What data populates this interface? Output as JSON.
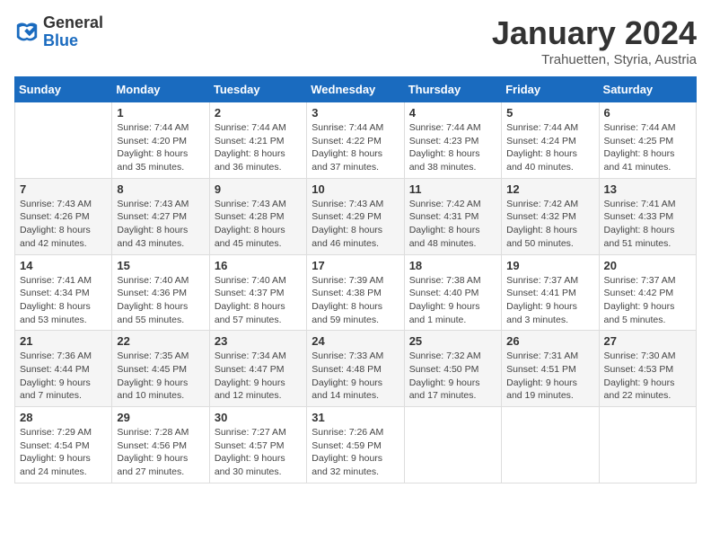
{
  "header": {
    "logo_general": "General",
    "logo_blue": "Blue",
    "month_title": "January 2024",
    "subtitle": "Trahuetten, Styria, Austria"
  },
  "weekdays": [
    "Sunday",
    "Monday",
    "Tuesday",
    "Wednesday",
    "Thursday",
    "Friday",
    "Saturday"
  ],
  "weeks": [
    [
      {
        "day": "",
        "sunrise": "",
        "sunset": "",
        "daylight": ""
      },
      {
        "day": "1",
        "sunrise": "Sunrise: 7:44 AM",
        "sunset": "Sunset: 4:20 PM",
        "daylight": "Daylight: 8 hours and 35 minutes."
      },
      {
        "day": "2",
        "sunrise": "Sunrise: 7:44 AM",
        "sunset": "Sunset: 4:21 PM",
        "daylight": "Daylight: 8 hours and 36 minutes."
      },
      {
        "day": "3",
        "sunrise": "Sunrise: 7:44 AM",
        "sunset": "Sunset: 4:22 PM",
        "daylight": "Daylight: 8 hours and 37 minutes."
      },
      {
        "day": "4",
        "sunrise": "Sunrise: 7:44 AM",
        "sunset": "Sunset: 4:23 PM",
        "daylight": "Daylight: 8 hours and 38 minutes."
      },
      {
        "day": "5",
        "sunrise": "Sunrise: 7:44 AM",
        "sunset": "Sunset: 4:24 PM",
        "daylight": "Daylight: 8 hours and 40 minutes."
      },
      {
        "day": "6",
        "sunrise": "Sunrise: 7:44 AM",
        "sunset": "Sunset: 4:25 PM",
        "daylight": "Daylight: 8 hours and 41 minutes."
      }
    ],
    [
      {
        "day": "7",
        "sunrise": "Sunrise: 7:43 AM",
        "sunset": "Sunset: 4:26 PM",
        "daylight": "Daylight: 8 hours and 42 minutes."
      },
      {
        "day": "8",
        "sunrise": "Sunrise: 7:43 AM",
        "sunset": "Sunset: 4:27 PM",
        "daylight": "Daylight: 8 hours and 43 minutes."
      },
      {
        "day": "9",
        "sunrise": "Sunrise: 7:43 AM",
        "sunset": "Sunset: 4:28 PM",
        "daylight": "Daylight: 8 hours and 45 minutes."
      },
      {
        "day": "10",
        "sunrise": "Sunrise: 7:43 AM",
        "sunset": "Sunset: 4:29 PM",
        "daylight": "Daylight: 8 hours and 46 minutes."
      },
      {
        "day": "11",
        "sunrise": "Sunrise: 7:42 AM",
        "sunset": "Sunset: 4:31 PM",
        "daylight": "Daylight: 8 hours and 48 minutes."
      },
      {
        "day": "12",
        "sunrise": "Sunrise: 7:42 AM",
        "sunset": "Sunset: 4:32 PM",
        "daylight": "Daylight: 8 hours and 50 minutes."
      },
      {
        "day": "13",
        "sunrise": "Sunrise: 7:41 AM",
        "sunset": "Sunset: 4:33 PM",
        "daylight": "Daylight: 8 hours and 51 minutes."
      }
    ],
    [
      {
        "day": "14",
        "sunrise": "Sunrise: 7:41 AM",
        "sunset": "Sunset: 4:34 PM",
        "daylight": "Daylight: 8 hours and 53 minutes."
      },
      {
        "day": "15",
        "sunrise": "Sunrise: 7:40 AM",
        "sunset": "Sunset: 4:36 PM",
        "daylight": "Daylight: 8 hours and 55 minutes."
      },
      {
        "day": "16",
        "sunrise": "Sunrise: 7:40 AM",
        "sunset": "Sunset: 4:37 PM",
        "daylight": "Daylight: 8 hours and 57 minutes."
      },
      {
        "day": "17",
        "sunrise": "Sunrise: 7:39 AM",
        "sunset": "Sunset: 4:38 PM",
        "daylight": "Daylight: 8 hours and 59 minutes."
      },
      {
        "day": "18",
        "sunrise": "Sunrise: 7:38 AM",
        "sunset": "Sunset: 4:40 PM",
        "daylight": "Daylight: 9 hours and 1 minute."
      },
      {
        "day": "19",
        "sunrise": "Sunrise: 7:37 AM",
        "sunset": "Sunset: 4:41 PM",
        "daylight": "Daylight: 9 hours and 3 minutes."
      },
      {
        "day": "20",
        "sunrise": "Sunrise: 7:37 AM",
        "sunset": "Sunset: 4:42 PM",
        "daylight": "Daylight: 9 hours and 5 minutes."
      }
    ],
    [
      {
        "day": "21",
        "sunrise": "Sunrise: 7:36 AM",
        "sunset": "Sunset: 4:44 PM",
        "daylight": "Daylight: 9 hours and 7 minutes."
      },
      {
        "day": "22",
        "sunrise": "Sunrise: 7:35 AM",
        "sunset": "Sunset: 4:45 PM",
        "daylight": "Daylight: 9 hours and 10 minutes."
      },
      {
        "day": "23",
        "sunrise": "Sunrise: 7:34 AM",
        "sunset": "Sunset: 4:47 PM",
        "daylight": "Daylight: 9 hours and 12 minutes."
      },
      {
        "day": "24",
        "sunrise": "Sunrise: 7:33 AM",
        "sunset": "Sunset: 4:48 PM",
        "daylight": "Daylight: 9 hours and 14 minutes."
      },
      {
        "day": "25",
        "sunrise": "Sunrise: 7:32 AM",
        "sunset": "Sunset: 4:50 PM",
        "daylight": "Daylight: 9 hours and 17 minutes."
      },
      {
        "day": "26",
        "sunrise": "Sunrise: 7:31 AM",
        "sunset": "Sunset: 4:51 PM",
        "daylight": "Daylight: 9 hours and 19 minutes."
      },
      {
        "day": "27",
        "sunrise": "Sunrise: 7:30 AM",
        "sunset": "Sunset: 4:53 PM",
        "daylight": "Daylight: 9 hours and 22 minutes."
      }
    ],
    [
      {
        "day": "28",
        "sunrise": "Sunrise: 7:29 AM",
        "sunset": "Sunset: 4:54 PM",
        "daylight": "Daylight: 9 hours and 24 minutes."
      },
      {
        "day": "29",
        "sunrise": "Sunrise: 7:28 AM",
        "sunset": "Sunset: 4:56 PM",
        "daylight": "Daylight: 9 hours and 27 minutes."
      },
      {
        "day": "30",
        "sunrise": "Sunrise: 7:27 AM",
        "sunset": "Sunset: 4:57 PM",
        "daylight": "Daylight: 9 hours and 30 minutes."
      },
      {
        "day": "31",
        "sunrise": "Sunrise: 7:26 AM",
        "sunset": "Sunset: 4:59 PM",
        "daylight": "Daylight: 9 hours and 32 minutes."
      },
      {
        "day": "",
        "sunrise": "",
        "sunset": "",
        "daylight": ""
      },
      {
        "day": "",
        "sunrise": "",
        "sunset": "",
        "daylight": ""
      },
      {
        "day": "",
        "sunrise": "",
        "sunset": "",
        "daylight": ""
      }
    ]
  ]
}
